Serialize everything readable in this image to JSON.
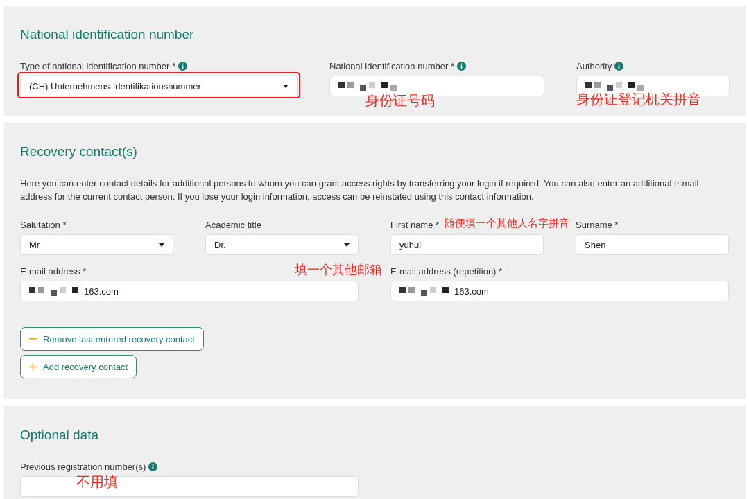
{
  "sections": [
    {
      "title": "National identification number",
      "fields": [
        {
          "kind": "select",
          "label": "Type of national identification number *",
          "info": true,
          "value": "(CH) Unternehmens-Identifikationsnummer",
          "highlighted": true
        },
        {
          "kind": "input",
          "label": "National identification number *",
          "info": true,
          "redacted": true,
          "note": "身份证号码"
        },
        {
          "kind": "input",
          "label": "Authority",
          "info": true,
          "redacted": true,
          "note": "身份证登记机关拼音"
        }
      ]
    },
    {
      "title": "Recovery contact(s)",
      "description": "Here you can enter contact details for additional persons to whom you can grant access rights by transferring your login if required. You can also enter an additional e-mail address for the current contact person. If you lose your login information, access can be reinstated using this contact information.",
      "fields": [
        {
          "kind": "select",
          "label": "Salutation *",
          "info": false,
          "value": "Mr"
        },
        {
          "kind": "select",
          "label": "Academic title",
          "info": false,
          "value": "Dr."
        },
        {
          "kind": "input",
          "label": "First name *",
          "info": false,
          "value": "yuhui",
          "note": "随便填一个其他人名字拼音"
        },
        {
          "kind": "input",
          "label": "Surname *",
          "info": false,
          "value": "Shen"
        },
        {
          "kind": "input",
          "label": "E-mail address *",
          "info": false,
          "redacted": true,
          "value": "163.com",
          "note": "填一个其他邮箱"
        },
        {
          "kind": "input",
          "label": "E-mail address (repetition) *",
          "info": false,
          "redacted": true,
          "value": "163.com"
        }
      ],
      "buttons": [
        {
          "kind": "remove",
          "label": "Remove last entered recovery contact"
        },
        {
          "kind": "add",
          "label": "Add recovery contact"
        }
      ]
    },
    {
      "title": "Optional data",
      "fields": [
        {
          "kind": "input",
          "label": "Previous registration number(s)",
          "info": true,
          "note": "不用填"
        }
      ]
    }
  ]
}
